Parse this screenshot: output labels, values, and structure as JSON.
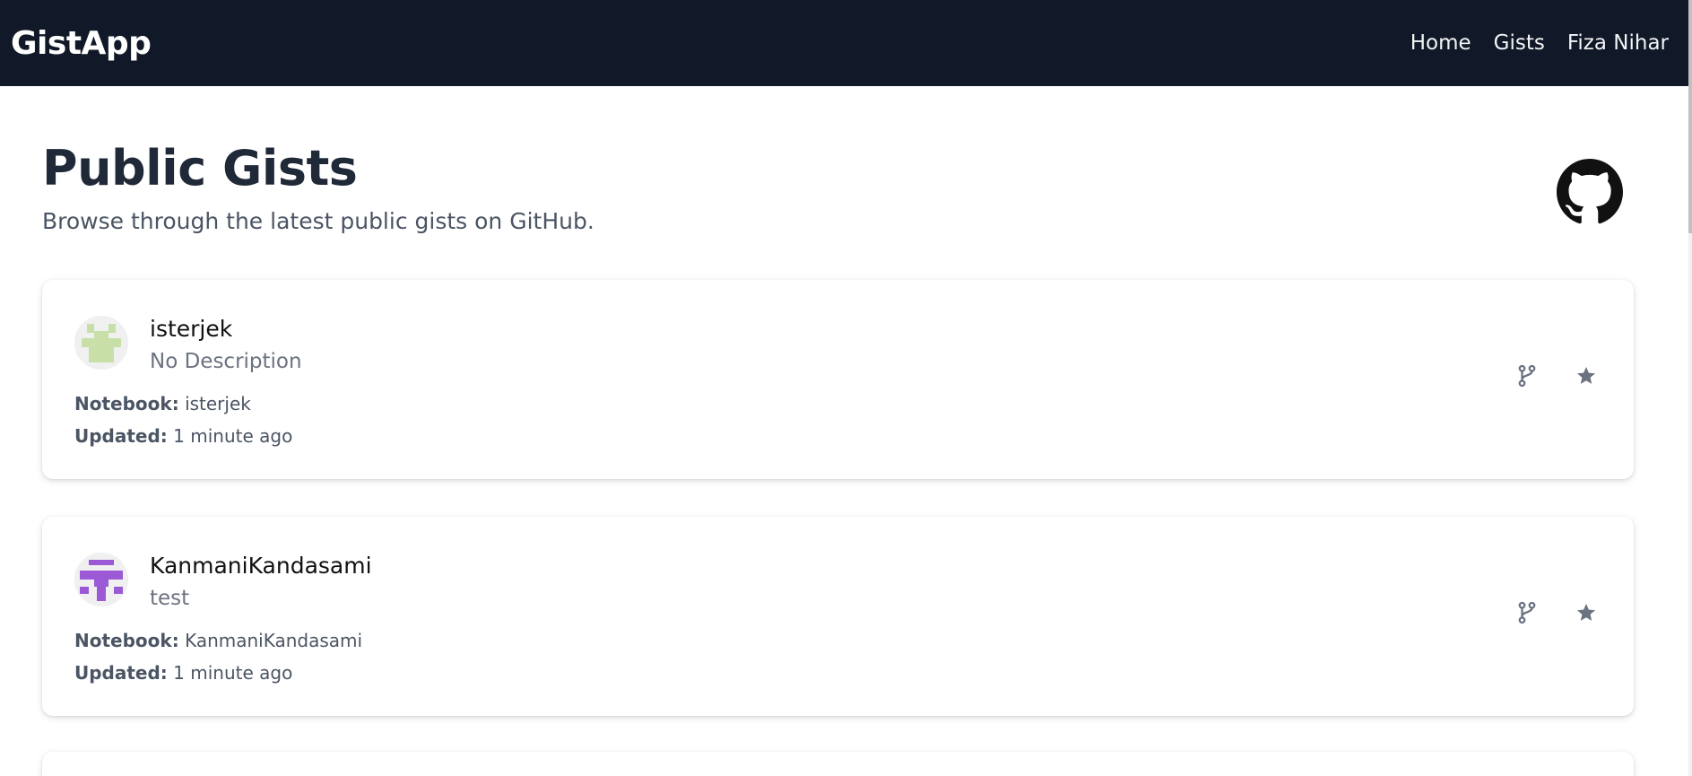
{
  "navbar": {
    "brand": "GistApp",
    "links": [
      {
        "label": "Home"
      },
      {
        "label": "Gists"
      },
      {
        "label": "Fiza Nihar"
      }
    ]
  },
  "header": {
    "title": "Public Gists",
    "subtitle": "Browse through the latest public gists on GitHub.",
    "logo_icon": "github-icon"
  },
  "gists": [
    {
      "username": "isterjek",
      "description": "No Description",
      "notebook_label": "Notebook:",
      "notebook": "isterjek",
      "updated_label": "Updated:",
      "updated": "1 minute ago",
      "avatar_color": "#c8e0a8",
      "icons": [
        "fork-icon",
        "star-icon"
      ]
    },
    {
      "username": "KanmaniKandasami",
      "description": "test",
      "notebook_label": "Notebook:",
      "notebook": "KanmaniKandasami",
      "updated_label": "Updated:",
      "updated": "1 minute ago",
      "avatar_color": "#9b59d6",
      "icons": [
        "fork-icon",
        "star-icon"
      ]
    }
  ],
  "colors": {
    "navbar_bg": "#111827",
    "icon_gray": "#6b7280"
  }
}
